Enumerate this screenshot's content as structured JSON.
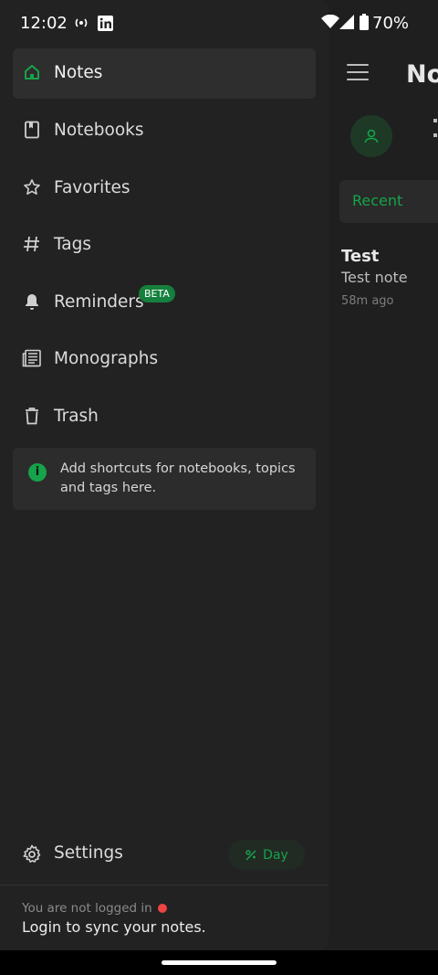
{
  "status": {
    "time": "12:02",
    "battery": "70%",
    "icons": [
      "cast-icon",
      "linkedin-icon",
      "wifi-icon",
      "signal-icon",
      "battery-icon"
    ]
  },
  "drawer": {
    "nav": [
      {
        "label": "Notes",
        "icon": "home-icon",
        "active": true
      },
      {
        "label": "Notebooks",
        "icon": "book-icon"
      },
      {
        "label": "Favorites",
        "icon": "star-icon"
      },
      {
        "label": "Tags",
        "icon": "hash-icon"
      },
      {
        "label": "Reminders",
        "icon": "bell-icon",
        "badge": "BETA"
      },
      {
        "label": "Monographs",
        "icon": "newspaper-icon"
      },
      {
        "label": "Trash",
        "icon": "trash-icon"
      }
    ],
    "shortcut_hint": "Add shortcuts for notebooks, topics and tags here.",
    "settings_label": "Settings",
    "theme_toggle_label": "Day",
    "login_status": "You are not logged in",
    "login_cta": "Login to sync your notes."
  },
  "main": {
    "title": "No",
    "tab_label": "Recent",
    "note": {
      "title": "Test",
      "body": "Test note",
      "time": "58m ago"
    }
  },
  "colors": {
    "accent": "#16a34a",
    "drawer_bg": "#222222",
    "alert_dot": "#ef4444"
  }
}
